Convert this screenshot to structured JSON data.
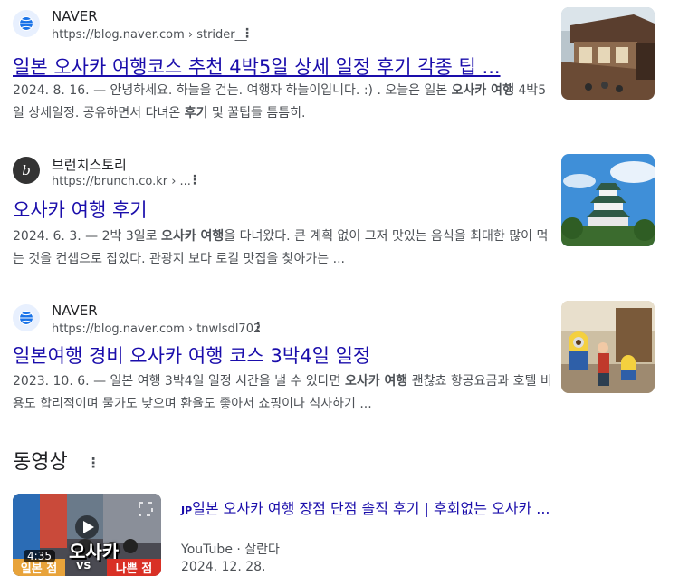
{
  "results": [
    {
      "site_name": "NAVER",
      "url": "https://blog.naver.com › strider__",
      "title": "일본 오사카 여행코스 추천 4박5일 상세 일정 후기 각종 팁 ...",
      "date": "2024. 8. 16.",
      "snippet_parts": [
        "— 안녕하세요. 하늘을 걷는. 여행자 하늘이입니다. :) . 오늘은 일본 ",
        "오사카 여행",
        " 4박5일 상세일정. 공유하면서 다녀온 ",
        "후기",
        " 및 꿀팁들 틈틈히."
      ]
    },
    {
      "site_name": "브런치스토리",
      "url": "https://brunch.co.kr › ...",
      "title": "오사카 여행 후기",
      "date": "2024. 6. 3.",
      "snippet_parts": [
        "— 2박 3일로 ",
        "오사카 여행",
        "을 다녀왔다. 큰 계획 없이 그저 맛있는 음식을 최대한 많이 먹는 것을 컨셉으로 잡았다. 관광지 보다 로컬 맛집을 찾아가는 ..."
      ]
    },
    {
      "site_name": "NAVER",
      "url": "https://blog.naver.com › tnwlsdl702",
      "title": "일본여행 경비 오사카 여행 코스 3박4일 일정",
      "date": "2023. 10. 6.",
      "snippet_parts": [
        "— 일본 여행 3박4일 일정 시간을 낼 수 있다면 ",
        "오사카 여행",
        " 괜찮쵸 항공요금과 호텔 비용도 합리적이며 물가도 낮으며 환율도 좋아서 쇼핑이나 식사하기 ..."
      ]
    }
  ],
  "videos": {
    "heading": "동영상",
    "item": {
      "badge": "JP",
      "title": "일본 오사카 여행 장점 단점 솔직 후기 | 후회없는 오사카 ...",
      "source": "YouTube",
      "channel": "살란다",
      "date": "2024. 12. 28.",
      "duration": "4:35",
      "thumb_text_main": "오사카",
      "thumb_text_left": "일본 점",
      "thumb_text_vs": "vs",
      "thumb_text_right": "나쁜 점"
    }
  },
  "icons": {
    "menu": "more-vert-icon",
    "naver_favicon": "globe-icon",
    "brunch_favicon": "brunch-b-icon"
  },
  "colors": {
    "link": "#1a0dab",
    "text": "#202124",
    "secondary": "#4d5156"
  }
}
